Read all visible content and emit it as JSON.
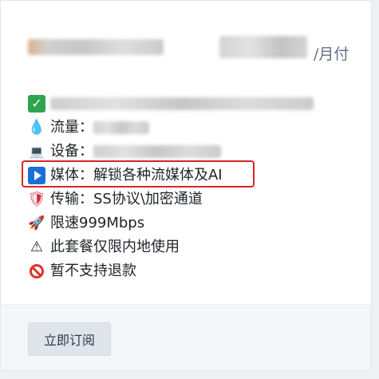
{
  "plan": {
    "period_label": "/月付"
  },
  "features": [
    {
      "icon": "check-icon",
      "label": ""
    },
    {
      "icon": "droplet-icon",
      "label": "流量："
    },
    {
      "icon": "laptop-icon",
      "label": "设备："
    },
    {
      "icon": "play-icon",
      "label": "媒体：解锁各种流媒体及AI"
    },
    {
      "icon": "shield-icon",
      "label": "传输：SS协议\\加密通道"
    },
    {
      "icon": "rocket-icon",
      "label": "限速999Mbps"
    },
    {
      "icon": "warning-icon",
      "label": "此套餐仅限内地使用"
    },
    {
      "icon": "prohibited-icon",
      "label": "暂不支持退款"
    }
  ],
  "footer": {
    "subscribe_label": "立即订阅"
  },
  "colors": {
    "highlight_border": "#d92424",
    "button_bg": "#dfe5eb",
    "check_green": "#2ea44f",
    "play_blue": "#1d6fd6"
  }
}
